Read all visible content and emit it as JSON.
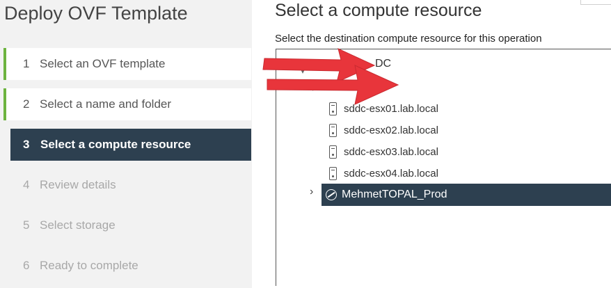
{
  "wizard": {
    "title": "Deploy OVF Template",
    "steps": [
      {
        "num": "1",
        "label": "Select an OVF template",
        "state": "done"
      },
      {
        "num": "2",
        "label": "Select a name and folder",
        "state": "done"
      },
      {
        "num": "3",
        "label": "Select a compute resource",
        "state": "active"
      },
      {
        "num": "4",
        "label": "Review details",
        "state": "disabled"
      },
      {
        "num": "5",
        "label": "Select storage",
        "state": "disabled"
      },
      {
        "num": "6",
        "label": "Ready to complete",
        "state": "disabled"
      }
    ]
  },
  "page": {
    "title": "Select a compute resource",
    "subtitle": "Select the destination compute resource for this operation"
  },
  "tree": {
    "datacenter_label": "DC",
    "hosts": [
      {
        "name": "sddc-esx01.lab.local",
        "icon": "host-icon"
      },
      {
        "name": "sddc-esx02.lab.local",
        "icon": "host-icon"
      },
      {
        "name": "sddc-esx03.lab.local",
        "icon": "host-icon"
      },
      {
        "name": "sddc-esx04.lab.local",
        "icon": "host-icon"
      }
    ],
    "selected_cluster": {
      "name": "MehmetTOPAL_Prod",
      "icon": "cluster-icon",
      "toggle": "chevron-right-icon"
    }
  },
  "colors": {
    "active_bg": "#2d4050",
    "done_marker": "#6db33f",
    "arrow": "#e8353b"
  }
}
